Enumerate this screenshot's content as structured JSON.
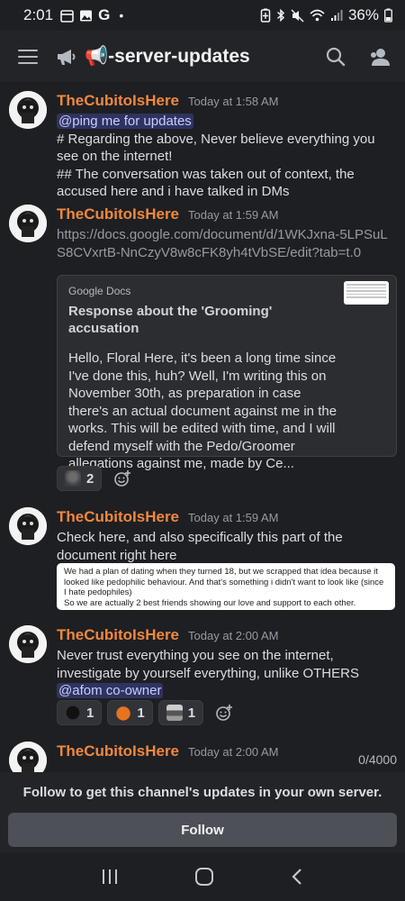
{
  "status_bar": {
    "time": "2:01",
    "notif_g": "G",
    "dot": "•",
    "battery": "36%"
  },
  "header": {
    "channel_name": "📢-server-updates"
  },
  "messages": [
    {
      "author": "TheCubitoIsHere",
      "timestamp": "Today at 1:58 AM",
      "mention": "@ping me for updates",
      "lines": "# Regarding the above, Never believe everything you see on the internet!\n## The conversation was taken out of context, the accused here and i have talked in DMs"
    },
    {
      "author": "TheCubitoIsHere",
      "timestamp": "Today at 1:59 AM",
      "link": "https://docs.google.com/document/d/1WKJxna-5LPSuLS8CVxrtB-NnCzyV8w8cFK8yh4tVbSE/edit?tab=t.0",
      "embed": {
        "provider": "Google Docs",
        "title": "Response about the 'Grooming' accusation",
        "description": "Hello, Floral Here, it's been a long time since I've done this, huh? Well, I'm writing this on November 30th, as preparation in case there's an actual document against me in the works. This will be edited with time, and I will defend myself with the Pedo/Groomer allegations against me, made by Ce..."
      },
      "reactions": [
        {
          "emoji": "avatar-emoji",
          "count": "2"
        }
      ]
    },
    {
      "author": "TheCubitoIsHere",
      "timestamp": "Today at 1:59 AM",
      "text": "Check here, and also specifically this part of the document right here",
      "image_text": "We had a plan of dating when they turned 18, but we scrapped that idea because it looked like pedophilic behaviour. And that's something i didn't want to look like (since I hate pedophiles)\nSo we are actually 2 best friends showing our love and support to each other."
    },
    {
      "author": "TheCubitoIsHere",
      "timestamp": "Today at 2:00 AM",
      "text": "Never trust everything you see on the internet, investigate by yourself everything, unlike OTHERS",
      "mention": "@afom co-owner",
      "reactions": [
        {
          "emoji": "dark-blob-emoji",
          "count": "1"
        },
        {
          "emoji": "pumpkin-emoji",
          "count": "1"
        },
        {
          "emoji": "picture-emoji",
          "count": "1"
        }
      ]
    },
    {
      "author": "TheCubitoIsHere",
      "timestamp": "Today at 2:00 AM"
    }
  ],
  "char_counter": "0/4000",
  "follow": {
    "prompt": "Follow to get this channel's updates in your own server.",
    "button_label": "Follow"
  },
  "colors": {
    "background": "#1e1f22",
    "author": "#f0883e",
    "mention_bg": "#3c4270",
    "button": "#4e5058"
  }
}
